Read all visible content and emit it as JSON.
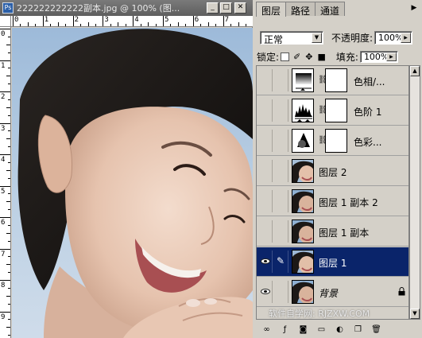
{
  "document": {
    "title": "222222222222副本.jpg @ 100% (图...",
    "app_icon_label": "Ps",
    "ruler_top": [
      "0",
      "1",
      "2",
      "3",
      "4",
      "5",
      "6",
      "7"
    ],
    "ruler_left": [
      "0",
      "1",
      "2",
      "3",
      "4",
      "5",
      "6",
      "7",
      "8",
      "9"
    ]
  },
  "panel": {
    "tabs": [
      {
        "label": "图层",
        "active": true
      },
      {
        "label": "路径",
        "active": false
      },
      {
        "label": "通道",
        "active": false
      }
    ],
    "blend_mode": "正常",
    "opacity_label": "不透明度:",
    "opacity_value": "100%",
    "lock_label": "锁定:",
    "fill_label": "填充:",
    "fill_value": "100%",
    "layers": [
      {
        "name": "色相/...",
        "type": "adjustment",
        "icon": "hue-saturation-icon",
        "visible": false,
        "selected": false
      },
      {
        "name": "色阶 1",
        "type": "adjustment",
        "icon": "levels-histogram-icon",
        "visible": false,
        "selected": false
      },
      {
        "name": "色彩...",
        "type": "adjustment",
        "icon": "color-balance-icon",
        "visible": false,
        "selected": false
      },
      {
        "name": "图层 2",
        "type": "pixel",
        "visible": false,
        "selected": false
      },
      {
        "name": "图层 1 副本 2",
        "type": "pixel",
        "visible": false,
        "selected": false
      },
      {
        "name": "图层 1 副本",
        "type": "pixel",
        "visible": false,
        "selected": false
      },
      {
        "name": "图层 1",
        "type": "pixel",
        "visible": true,
        "selected": true
      },
      {
        "name": "背景",
        "type": "background",
        "visible": true,
        "selected": false,
        "locked": true
      }
    ],
    "bottom_icons": [
      "link-layers-icon",
      "layer-style-icon",
      "add-mask-icon",
      "new-group-icon",
      "new-adjustment-icon",
      "new-layer-icon",
      "delete-layer-icon"
    ]
  },
  "watermark": "软件自学网: RJZXW.COM"
}
